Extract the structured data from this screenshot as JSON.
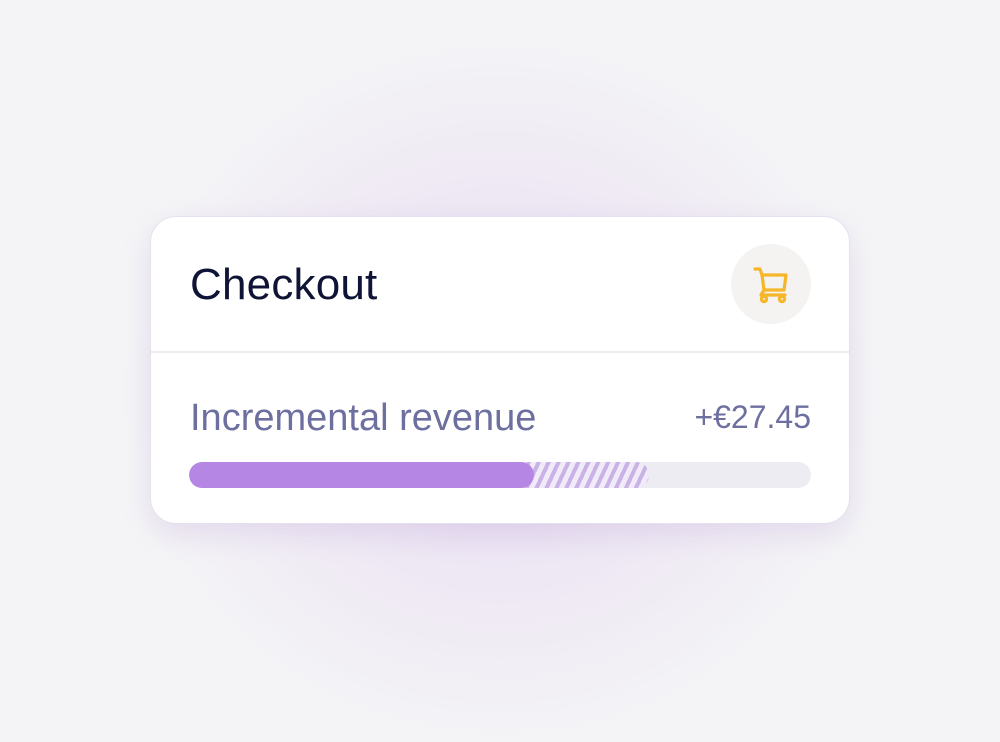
{
  "card": {
    "title": "Checkout",
    "icon": "shopping-cart-icon",
    "metric": {
      "label": "Incremental revenue",
      "value": "+€27.45",
      "progress_fraction": 0.555,
      "projected_fraction": 0.74
    }
  },
  "colors": {
    "accent_purple": "#b686e4",
    "cart_icon": "#f6b62a",
    "title_text": "#0f1436",
    "muted_text": "#6d6f9f"
  }
}
